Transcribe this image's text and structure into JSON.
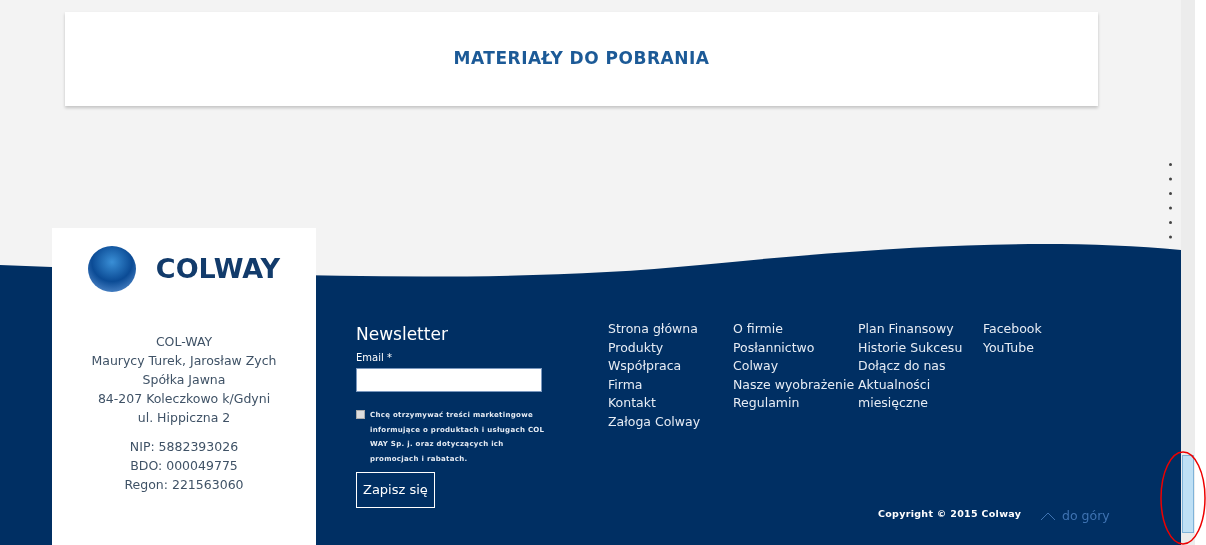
{
  "downloads": {
    "title": "MATERIAŁY DO POBRANIA"
  },
  "logo": {
    "text": "COLWAY"
  },
  "address": {
    "lines": [
      "COL-WAY",
      "Maurycy Turek, Jarosław Zych",
      "Spółka Jawna",
      "84-207 Koleczkowo k/Gdyni",
      "ul. Hippiczna 2"
    ],
    "ids": [
      "NIP: 5882393026",
      "BDO: 000049775",
      "Regon: 221563060"
    ]
  },
  "newsletter": {
    "title": "Newsletter",
    "email_label": "Email *",
    "consent": {
      "text": "Chcę otrzymywać treści marketingowe informujące o produktach i usługach COL WAY Sp. j. oraz dotyczących ich promocjach i rabatach.",
      "checked": false
    },
    "submit": "Zapisz się"
  },
  "link_columns": [
    [
      "Strona główna",
      "Produkty",
      "Współpraca",
      "Firma",
      "Kontakt",
      "Załoga Colway"
    ],
    [
      "O firmie",
      "Posłannictwo Colway",
      "Nasze wyobrażenie",
      "Regulamin"
    ],
    [
      "Plan Finansowy",
      "Historie Sukcesu",
      "Dołącz do nas",
      "Aktualności miesięczne"
    ],
    [
      "Facebook",
      "YouTube"
    ]
  ],
  "copyright": "Copyright © 2015 Colway",
  "back_to_top": "do góry"
}
